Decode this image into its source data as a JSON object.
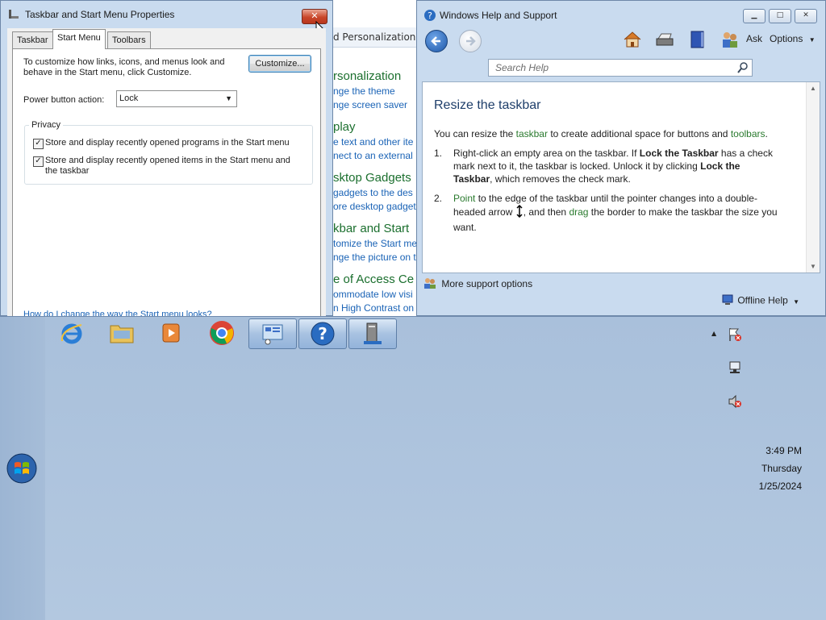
{
  "props": {
    "title": "Taskbar and Start Menu Properties",
    "close_glyph": "✕",
    "tabs": [
      "Taskbar",
      "Start Menu",
      "Toolbars"
    ],
    "intro": "To customize how links, icons, and menus look and behave in the Start menu, click Customize.",
    "customize_label": "Customize...",
    "power_label": "Power button action:",
    "power_value": "Lock",
    "privacy_label": "Privacy",
    "check1": "Store and display recently opened programs in the Start menu",
    "check2": "Store and display recently opened items in the Start menu and the taskbar",
    "help_link": "How do I change the way the Start menu looks?"
  },
  "control_panel": {
    "crumb": "d Personalization",
    "sections": [
      {
        "head": "rsonalization",
        "links": [
          "nge the theme",
          "nge screen saver"
        ]
      },
      {
        "head": "play",
        "links": [
          "e text and other ite",
          "nect to an external"
        ]
      },
      {
        "head": "sktop Gadgets",
        "links": [
          " gadgets to the des",
          "ore desktop gadget"
        ]
      },
      {
        "head": "kbar and Start",
        "links": [
          "tomize the Start me",
          "nge the picture on t"
        ]
      },
      {
        "head": "e of Access Ce",
        "links": [
          "ommodate low visi",
          "n High Contrast on"
        ]
      }
    ]
  },
  "help": {
    "title": "Windows Help and Support",
    "ask": "Ask",
    "options": "Options",
    "search_placeholder": "Search Help",
    "heading": "Resize the taskbar",
    "intro_pre": "You can resize the ",
    "intro_link1": "taskbar",
    "intro_mid": " to create additional space for buttons and ",
    "intro_link2": "toolbars",
    "intro_end": ".",
    "step1_num": "1.",
    "step1_a": "Right-click an empty area on the taskbar. If ",
    "step1_b": "Lock the Taskbar",
    "step1_c": " has a check mark next to it, the taskbar is locked. Unlock it by clicking ",
    "step1_d": "Lock the Taskbar",
    "step1_e": ", which removes the check mark.",
    "step2_num": "2.",
    "step2_link1": "Point",
    "step2_a": " to the edge of the taskbar until the pointer changes into a double-headed arrow ",
    "step2_b": ", and then ",
    "step2_link2": "drag",
    "step2_c": " the border to make the taskbar the size you want.",
    "more_support": "More support options",
    "offline_help": "Offline Help"
  },
  "clock": {
    "time": "3:49 PM",
    "day": "Thursday",
    "date": "1/25/2024"
  }
}
